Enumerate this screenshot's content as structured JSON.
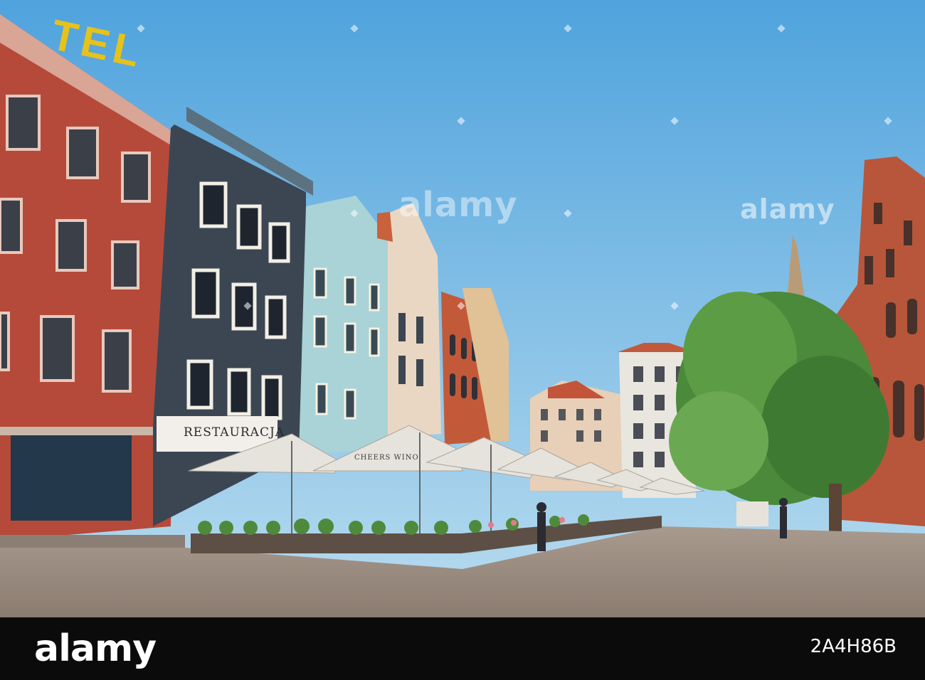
{
  "photo": {
    "sign_restaurant": "RESTAURACJA",
    "umbrella_text": "CHEERS WINO",
    "hotel_sign": "TEL"
  },
  "watermark": {
    "center": "alamy",
    "side": "alamy"
  },
  "footer": {
    "logo": "alamy",
    "image_id": "2A4H86B"
  }
}
